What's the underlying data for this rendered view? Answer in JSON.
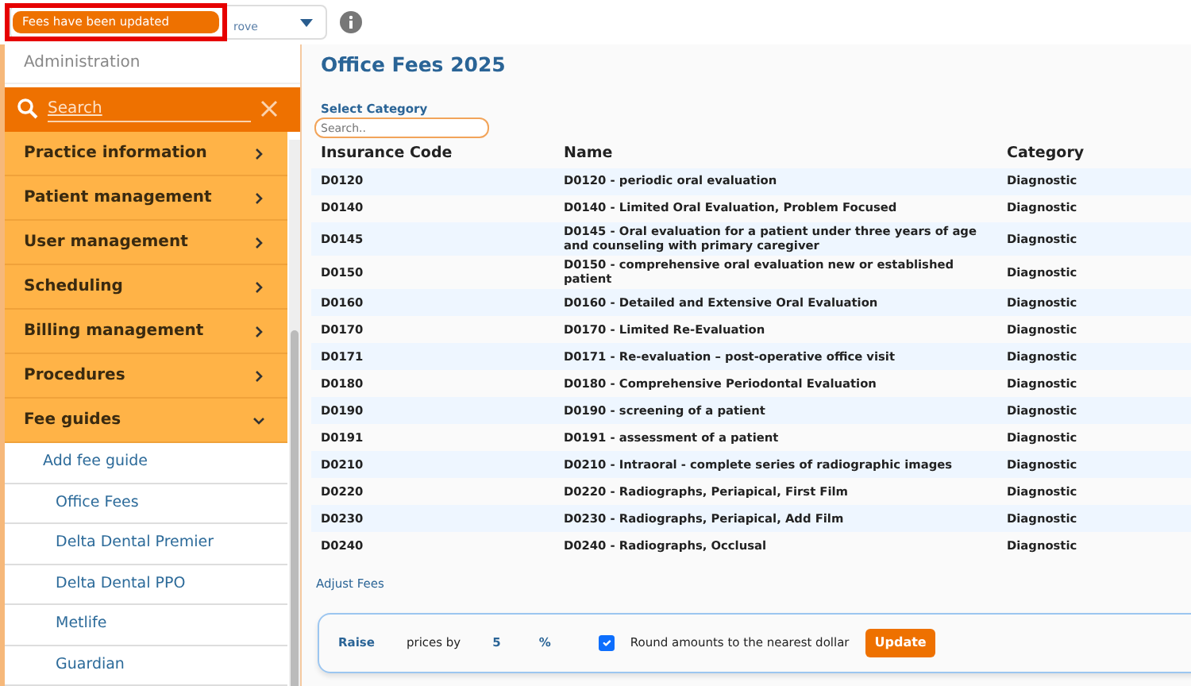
{
  "topbar": {
    "toast": "Fees have been updated",
    "dropdown_text": "rove"
  },
  "sidebar": {
    "header": "Administration",
    "search": {
      "placeholder": "Search"
    },
    "items": [
      {
        "label": "Practice information",
        "expanded": false
      },
      {
        "label": "Patient management",
        "expanded": false
      },
      {
        "label": "User management",
        "expanded": false
      },
      {
        "label": "Scheduling",
        "expanded": false
      },
      {
        "label": "Billing management",
        "expanded": false
      },
      {
        "label": "Procedures",
        "expanded": false
      },
      {
        "label": "Fee guides",
        "expanded": true,
        "children": [
          {
            "label": "Add fee guide",
            "kind": "action"
          },
          {
            "label": "Office Fees",
            "kind": "guide"
          },
          {
            "label": "Delta Dental Premier",
            "kind": "guide"
          },
          {
            "label": "Delta Dental PPO",
            "kind": "guide"
          },
          {
            "label": "Metlife",
            "kind": "guide"
          },
          {
            "label": "Guardian",
            "kind": "guide"
          }
        ]
      }
    ]
  },
  "main": {
    "title": "Office Fees 2025",
    "category_label": "Select Category",
    "category_search": {
      "placeholder": "Search.."
    },
    "table": {
      "columns": [
        "Insurance Code",
        "Name",
        "Category"
      ],
      "rows": [
        [
          "D0120",
          "D0120 - periodic oral evaluation",
          "Diagnostic"
        ],
        [
          "D0140",
          "D0140 - Limited Oral Evaluation, Problem Focused",
          "Diagnostic"
        ],
        [
          "D0145",
          "D0145 - Oral evaluation for a patient under three years of age and counseling with primary caregiver",
          "Diagnostic"
        ],
        [
          "D0150",
          "D0150 - comprehensive oral evaluation new or established patient",
          "Diagnostic"
        ],
        [
          "D0160",
          "D0160 - Detailed and Extensive Oral Evaluation",
          "Diagnostic"
        ],
        [
          "D0170",
          "D0170 - Limited Re-Evaluation",
          "Diagnostic"
        ],
        [
          "D0171",
          "D0171 - Re-evaluation – post-operative office visit",
          "Diagnostic"
        ],
        [
          "D0180",
          "D0180 - Comprehensive Periodontal Evaluation",
          "Diagnostic"
        ],
        [
          "D0190",
          "D0190 - screening of a patient",
          "Diagnostic"
        ],
        [
          "D0191",
          "D0191 - assessment of a patient",
          "Diagnostic"
        ],
        [
          "D0210",
          "D0210 - Intraoral - complete series of radiographic images",
          "Diagnostic"
        ],
        [
          "D0220",
          "D0220 - Radiographs, Periapical, First Film",
          "Diagnostic"
        ],
        [
          "D0230",
          "D0230 - Radiographs, Periapical, Add Film",
          "Diagnostic"
        ],
        [
          "D0240",
          "D0240 - Radiographs, Occlusal",
          "Diagnostic"
        ]
      ]
    },
    "adjust": {
      "label": "Adjust Fees",
      "direction": "Raise",
      "prices_by": "prices by",
      "amount": "5",
      "unit": "%",
      "round": {
        "label": "Round amounts to the nearest dollar",
        "checked": true
      },
      "button": "Update"
    }
  }
}
